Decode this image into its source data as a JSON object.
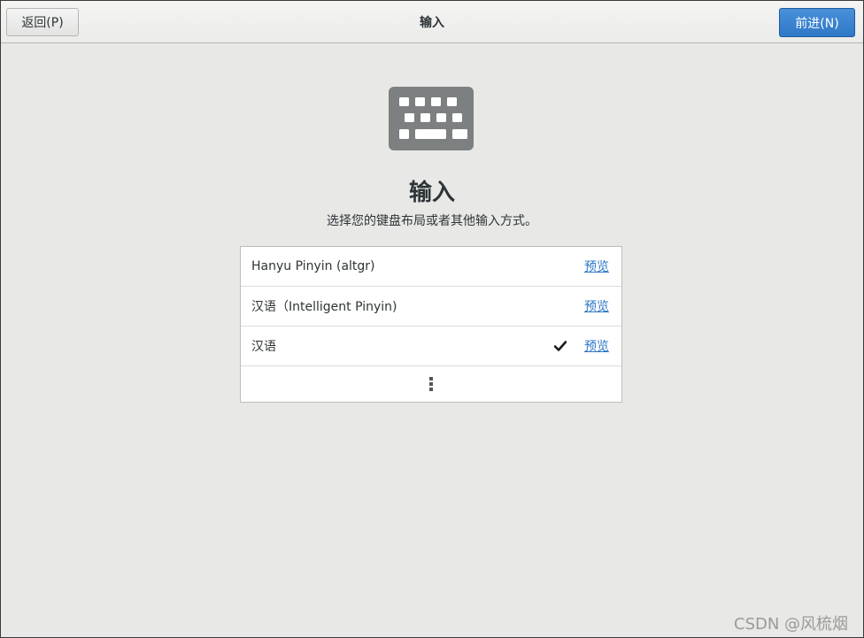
{
  "header": {
    "back_label": "返回(P)",
    "title": "输入",
    "next_label": "前进(N)"
  },
  "main": {
    "icon": "keyboard-icon",
    "title": "输入",
    "subtitle": "选择您的键盘布局或者其他输入方式。"
  },
  "input_sources": [
    {
      "name": "Hanyu Pinyin (altgr)",
      "action": "预览",
      "selected": false
    },
    {
      "name": "汉语（Intelligent Pinyin)",
      "action": "预览",
      "selected": false
    },
    {
      "name": "汉语",
      "action": "预览",
      "selected": true
    }
  ],
  "more_button_icon": "more-vertical-icon",
  "watermark": "CSDN @风梳烟",
  "colors": {
    "accent": "#2e78c7",
    "link": "#2a76c6",
    "background": "#e8e8e7"
  }
}
